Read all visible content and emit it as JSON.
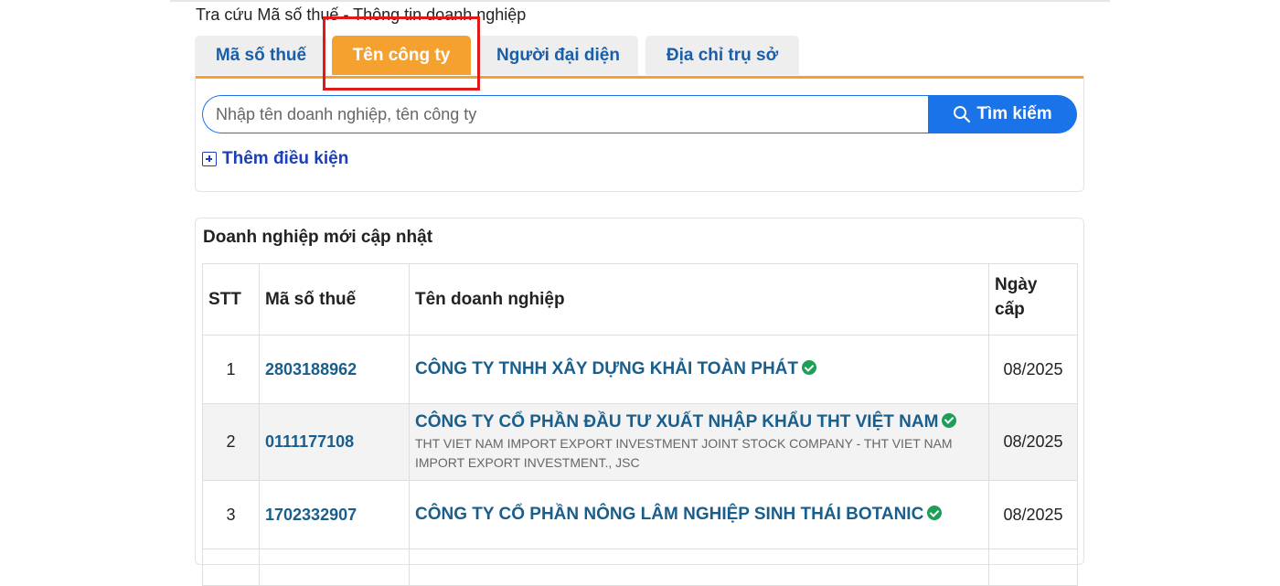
{
  "page": {
    "title": "Tra cứu Mã số thuế - Thông tin doanh nghiệp"
  },
  "tabs": [
    {
      "label": "Mã số thuế",
      "active": false
    },
    {
      "label": "Tên công ty",
      "active": true
    },
    {
      "label": "Người đại diện",
      "active": false
    },
    {
      "label": "Địa chỉ trụ sở",
      "active": false
    }
  ],
  "search": {
    "placeholder": "Nhập tên doanh nghiệp, tên công ty",
    "value": "",
    "button_label": "Tìm kiếm",
    "button_icon": "search-icon"
  },
  "add_condition": {
    "label": "Thêm điều kiện",
    "icon": "plus-square-icon"
  },
  "recent": {
    "title": "Doanh nghiệp mới cập nhật",
    "columns": {
      "stt": "STT",
      "mst": "Mã số thuế",
      "ten": "Tên doanh nghiệp",
      "ngay": "Ngày cấp"
    },
    "rows": [
      {
        "stt": "1",
        "mst": "2803188962",
        "ten": "CÔNG TY TNHH XÂY DỰNG KHẢI TOÀN PHÁT",
        "sub": "",
        "ngay": "08/2025",
        "verified": true
      },
      {
        "stt": "2",
        "mst": "0111177108",
        "ten": "CÔNG TY CỔ PHẦN ĐẦU TƯ XUẤT NHẬP KHẨU THT VIỆT NAM",
        "sub": "THT VIET NAM IMPORT EXPORT INVESTMENT JOINT STOCK COMPANY - THT VIET NAM IMPORT EXPORT INVESTMENT., JSC",
        "ngay": "08/2025",
        "verified": true
      },
      {
        "stt": "3",
        "mst": "1702332907",
        "ten": "CÔNG TY CỔ PHẦN NÔNG LÂM NGHIỆP SINH THÁI BOTANIC",
        "sub": "",
        "ngay": "08/2025",
        "verified": true
      }
    ]
  },
  "colors": {
    "accent": "#f4a12f",
    "primary": "#1a73e8",
    "link": "#1a5e8c",
    "verified": "#1e9e56",
    "highlight": "#e01a1a"
  }
}
